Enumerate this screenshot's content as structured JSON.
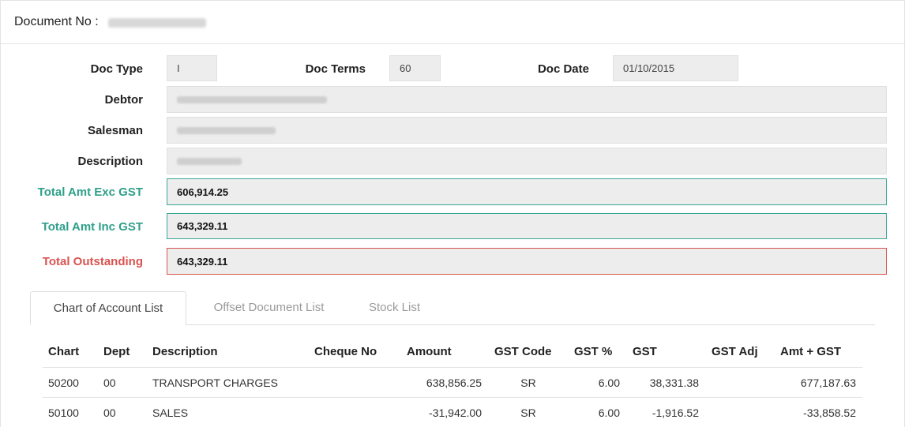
{
  "header": {
    "doc_label": "Document No :"
  },
  "form": {
    "doc_type_label": "Doc Type",
    "doc_type_value": "I",
    "doc_terms_label": "Doc Terms",
    "doc_terms_value": "60",
    "doc_date_label": "Doc Date",
    "doc_date_value": "01/10/2015",
    "debtor_label": "Debtor",
    "salesman_label": "Salesman",
    "description_label": "Description",
    "total_exc_label": "Total Amt Exc GST",
    "total_exc_value": "606,914.25",
    "total_inc_label": "Total Amt Inc GST",
    "total_inc_value": "643,329.11",
    "total_out_label": "Total Outstanding",
    "total_out_value": "643,329.11"
  },
  "tabs": [
    "Chart of Account List",
    "Offset Document List",
    "Stock List"
  ],
  "table": {
    "headers": [
      "Chart",
      "Dept",
      "Description",
      "Cheque No",
      "Amount",
      "GST Code",
      "GST %",
      "GST",
      "GST Adj",
      "Amt + GST"
    ],
    "rows": [
      [
        "50200",
        "00",
        "TRANSPORT CHARGES",
        "",
        "638,856.25",
        "SR",
        "6.00",
        "38,331.38",
        "",
        "677,187.63"
      ],
      [
        "50100",
        "00",
        "SALES",
        "",
        "-31,942.00",
        "SR",
        "6.00",
        "-1,916.52",
        "",
        "-33,858.52"
      ]
    ]
  },
  "colors": {
    "green": "#2ea08a",
    "red": "#d9534f"
  }
}
